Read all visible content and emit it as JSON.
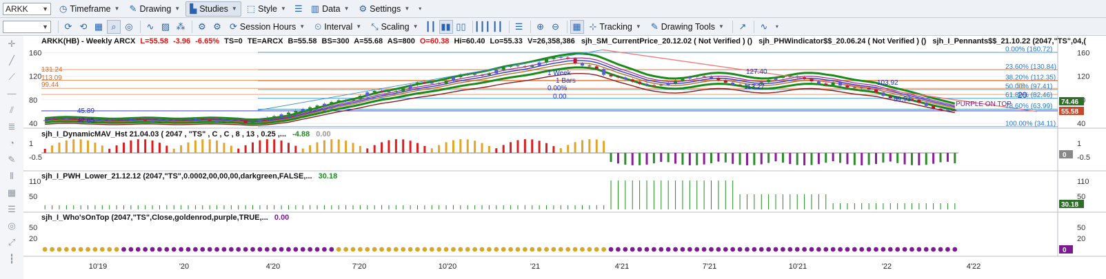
{
  "toolbar1": {
    "symbol": "ARKK",
    "buttons": {
      "timeframe": "Timeframe",
      "drawing": "Drawing",
      "studies": "Studies",
      "style": "Style",
      "data": "Data",
      "settings": "Settings"
    }
  },
  "toolbar2": {
    "buttons": {
      "session_hours": "Session Hours",
      "interval": "Interval",
      "scaling": "Scaling",
      "tracking": "Tracking",
      "drawing_tools": "Drawing Tools"
    }
  },
  "price_pane": {
    "header": {
      "symbol": "ARKK(HB) - Weekly  ARCX",
      "last": "L=55.58",
      "chg": "-3.96",
      "pct": "-6.65%",
      "ts": "TS=0",
      "te": "TE=ARCX",
      "bid": "B=55.58",
      "bs": "BS=300",
      "ask": "A=55.68",
      "as": "AS=800",
      "open": "O=60.38",
      "hi": "Hi=60.40",
      "lo": "Lo=55.33",
      "vol": "V=26,358,386",
      "study1": "sjh_SM_CurrentPrice_20.12.02 ( Not Verified ) ()",
      "study2": "sjh_PHWindicator$$_20.06.24 ( Not Verified ) ()",
      "study3": "sjh_I_Pennants$$_21.10.22 (2047,\"TS\",04,("
    },
    "axis_ticks": [
      "160",
      "120",
      "80",
      "40"
    ],
    "fib_labels": [
      "0.00% (160.72)",
      "23.60% (130.84)",
      "38.20% (112.35)",
      "50.00% (97.41)",
      "61.80% (82.46)",
      "78.60% (63.99)",
      "100.00% (34.11)"
    ],
    "left_levels": [
      "131.24",
      "113.09",
      "99.44"
    ],
    "annotations": [
      "45.89",
      "42.65",
      "1 Week",
      "1 Bars",
      "0.00%",
      "0.00",
      "127.40",
      "113.27",
      "103.92",
      "89.93",
      "50",
      "20",
      "PURPLE ON TOP"
    ],
    "badges": {
      "b1": "74.46",
      "b2": "55.58"
    },
    "colors": {
      "up": "#1e8a1e",
      "down": "#c8102e",
      "fib": "#3b8fd9",
      "fib_label": "#1f78d6"
    }
  },
  "pane2": {
    "title": "sjh_I_DynamicMAV_Hst 21.04.03 ( 2047 , \"TS\" , C , C ,  8 , 13 , 0.25 ,...",
    "v1": "-4.88",
    "v2": "0.00",
    "axis_ticks": [
      "1",
      "-0.5"
    ],
    "badge": "0"
  },
  "pane3": {
    "title": "sjh_I_PWH_Lower_21.12.12 (2047,\"TS\",0.0002,00,00,00,darkgreen,FALSE,...",
    "v1": "30.18",
    "axis_ticks": [
      "110",
      "50"
    ],
    "badge": "30.18"
  },
  "pane4": {
    "title": "sjh_I_Who'sOnTop (2047,\"TS\",Close,goldenrod,purple,TRUE,...",
    "v1": "0.00",
    "axis_ticks": [
      "50",
      "20"
    ],
    "badge": "0"
  },
  "xaxis": {
    "labels": [
      "10'19",
      "'20",
      "4'20",
      "7'20",
      "10'20",
      "'21",
      "4'21",
      "7'21",
      "10'21",
      "'22",
      "4'22"
    ]
  },
  "chart_data": {
    "type": "line",
    "series": [],
    "x": [
      "10'19",
      "'20",
      "4'20",
      "7'20",
      "10'20",
      "'21",
      "4'21",
      "7'21",
      "10'21",
      "'22",
      "4'22"
    ],
    "ylim": [
      34,
      170
    ]
  }
}
